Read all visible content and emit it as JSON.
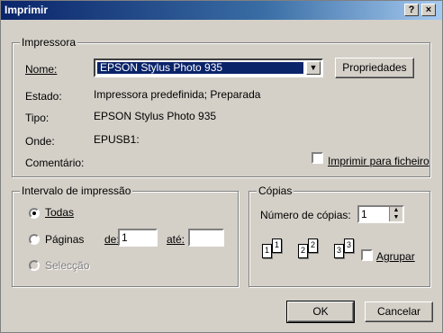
{
  "window": {
    "title": "Imprimir",
    "help_btn": "?",
    "close_btn": "×"
  },
  "printer": {
    "group_label": "Impressora",
    "name_label": "Nome:",
    "name_value": "EPSON Stylus Photo 935",
    "properties_button": "Propriedades",
    "status_label": "Estado:",
    "status_value": "Impressora predefinida; Preparada",
    "type_label": "Tipo:",
    "type_value": "EPSON Stylus Photo 935",
    "where_label": "Onde:",
    "where_value": "EPUSB1:",
    "comment_label": "Comentário:",
    "print_to_file_label": "Imprimir para ficheiro",
    "print_to_file_checked": false
  },
  "range": {
    "group_label": "Intervalo de impressão",
    "all_label": "Todas",
    "pages_label": "Páginas",
    "from_label": "de:",
    "from_value": "1",
    "to_label": "até:",
    "to_value": "",
    "selection_label": "Selecção",
    "selected": "all"
  },
  "copies": {
    "group_label": "Cópias",
    "count_label": "Número de cópias:",
    "count_value": "1",
    "collate_label": "Agrupar",
    "collate_checked": false,
    "page_digits": [
      "1",
      "1",
      "2",
      "2",
      "3",
      "3"
    ]
  },
  "buttons": {
    "ok": "OK",
    "cancel": "Cancelar"
  },
  "colors": {
    "title_bar": "#0a246a",
    "face": "#d4d0c8"
  }
}
